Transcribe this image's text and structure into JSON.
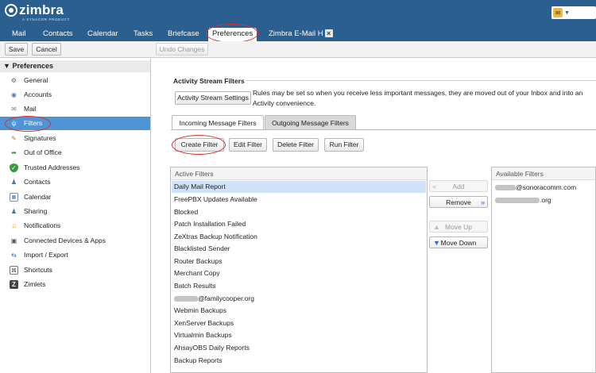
{
  "app": {
    "logo_text": "zimbra",
    "logo_sub": "A SYNACOR PRODUCT"
  },
  "search": {
    "icon": "search-icon"
  },
  "tabs": [
    {
      "label": "Mail"
    },
    {
      "label": "Contacts"
    },
    {
      "label": "Calendar"
    },
    {
      "label": "Tasks"
    },
    {
      "label": "Briefcase"
    },
    {
      "label": "Preferences",
      "active": true
    },
    {
      "label": "Zimbra E-Mail H",
      "closable": true
    }
  ],
  "toolbar": {
    "save": "Save",
    "cancel": "Cancel",
    "undo": "Undo Changes"
  },
  "sidebar": {
    "header": "Preferences",
    "items": [
      {
        "label": "General",
        "icon": "gear-icon"
      },
      {
        "label": "Accounts",
        "icon": "accounts-icon"
      },
      {
        "label": "Mail",
        "icon": "mail-icon"
      },
      {
        "label": "Filters",
        "icon": "filter-icon",
        "selected": true
      },
      {
        "label": "Signatures",
        "icon": "signature-icon"
      },
      {
        "label": "Out of Office",
        "icon": "out-of-office-icon"
      },
      {
        "label": "Trusted Addresses",
        "icon": "shield-check-icon"
      },
      {
        "label": "Contacts",
        "icon": "contacts-icon"
      },
      {
        "label": "Calendar",
        "icon": "calendar-icon"
      },
      {
        "label": "Sharing",
        "icon": "sharing-icon"
      },
      {
        "label": "Notifications",
        "icon": "bell-icon"
      },
      {
        "label": "Connected Devices & Apps",
        "icon": "devices-icon"
      },
      {
        "label": "Import / Export",
        "icon": "import-export-icon"
      },
      {
        "label": "Shortcuts",
        "icon": "shortcuts-icon"
      },
      {
        "label": "Zimlets",
        "icon": "zimlets-icon"
      }
    ]
  },
  "activity_stream": {
    "title": "Activity Stream Filters",
    "settings_button": "Activity Stream Settings",
    "description": "Rules may be set so when you receive less important messages, they are moved out of your Inbox and into an Activity convenience."
  },
  "subtabs": {
    "incoming": "Incoming Message Filters",
    "outgoing": "Outgoing Message Filters"
  },
  "filter_actions": {
    "create": "Create Filter",
    "edit": "Edit Filter",
    "delete": "Delete Filter",
    "run": "Run Filter"
  },
  "active_filters": {
    "header": "Active Filters",
    "rows": [
      {
        "label": "Daily Mail Report",
        "selected": true
      },
      {
        "label": "FreePBX Updates Available"
      },
      {
        "label": "Blocked"
      },
      {
        "label": "Patch Installation Failed"
      },
      {
        "label": "ZeXtras Backup Notification"
      },
      {
        "label": "Blacklisted Sender"
      },
      {
        "label": "Router Backups"
      },
      {
        "label": "Merchant Copy"
      },
      {
        "label": "Batch Results"
      },
      {
        "label": "@familycooper.org",
        "obscured_prefix": true
      },
      {
        "label": "Webmin Backups"
      },
      {
        "label": "XenServer Backups"
      },
      {
        "label": "Virtualmin Backups"
      },
      {
        "label": "AhsayOBS Daily Reports"
      },
      {
        "label": "Backup Reports"
      }
    ]
  },
  "move_buttons": {
    "add": "Add",
    "remove": "Remove",
    "move_up": "Move Up",
    "move_down": "Move Down"
  },
  "available_filters": {
    "header": "Available Filters",
    "rows": [
      {
        "label": "@sonoracomm.com",
        "obscured_prefix": true
      },
      {
        "label": ".org",
        "obscured_prefix": true
      }
    ]
  },
  "colors": {
    "topbar": "#2a5f8f",
    "selection": "#4f94d4",
    "annotation": "#d8302f"
  }
}
